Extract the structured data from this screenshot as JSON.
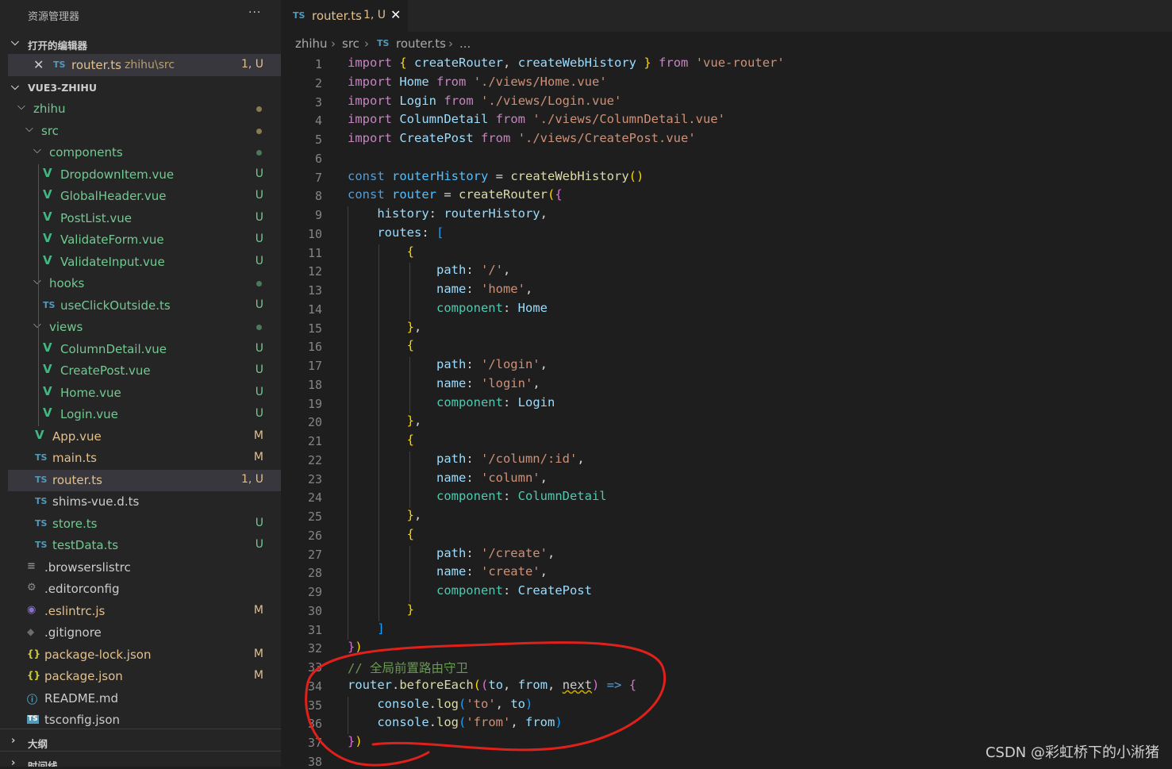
{
  "sidebar": {
    "title": "资源管理器",
    "more": "···",
    "open_editors_header": "打开的编辑器",
    "open_editor": {
      "close": "✕",
      "icon": "TS",
      "name": "router.ts",
      "path": "zhihu\\src",
      "status": "1, U"
    },
    "project_header": "VUE3-ZHIHU",
    "outline_header": "大纲",
    "timeline_header": "时间线",
    "tree": [
      {
        "label": "zhihu",
        "type": "folder",
        "depth": 1,
        "badge_dot": "#8a7a4f"
      },
      {
        "label": "src",
        "type": "folder",
        "depth": 2,
        "badge_dot": "#8a7a4f"
      },
      {
        "label": "components",
        "type": "folder",
        "depth": 3,
        "badge_dot": "#4b7a5a"
      },
      {
        "label": "DropdownItem.vue",
        "type": "vue",
        "depth": 4,
        "badge": "U"
      },
      {
        "label": "GlobalHeader.vue",
        "type": "vue",
        "depth": 4,
        "badge": "U"
      },
      {
        "label": "PostList.vue",
        "type": "vue",
        "depth": 4,
        "badge": "U"
      },
      {
        "label": "ValidateForm.vue",
        "type": "vue",
        "depth": 4,
        "badge": "U"
      },
      {
        "label": "ValidateInput.vue",
        "type": "vue",
        "depth": 4,
        "badge": "U"
      },
      {
        "label": "hooks",
        "type": "folder",
        "depth": 3,
        "badge_dot": "#4b7a5a"
      },
      {
        "label": "useClickOutside.ts",
        "type": "ts",
        "depth": 4,
        "badge": "U"
      },
      {
        "label": "views",
        "type": "folder",
        "depth": 3,
        "badge_dot": "#4b7a5a"
      },
      {
        "label": "ColumnDetail.vue",
        "type": "vue",
        "depth": 4,
        "badge": "U"
      },
      {
        "label": "CreatePost.vue",
        "type": "vue",
        "depth": 4,
        "badge": "U"
      },
      {
        "label": "Home.vue",
        "type": "vue",
        "depth": 4,
        "badge": "U"
      },
      {
        "label": "Login.vue",
        "type": "vue",
        "depth": 4,
        "badge": "U"
      },
      {
        "label": "App.vue",
        "type": "vue",
        "depth": 3,
        "badge": "M"
      },
      {
        "label": "main.ts",
        "type": "ts",
        "depth": 3,
        "badge": "M"
      },
      {
        "label": "router.ts",
        "type": "ts",
        "depth": 3,
        "badge": "1, U",
        "selected": true
      },
      {
        "label": "shims-vue.d.ts",
        "type": "ts",
        "depth": 3,
        "badge": ""
      },
      {
        "label": "store.ts",
        "type": "ts",
        "depth": 3,
        "badge": "U"
      },
      {
        "label": "testData.ts",
        "type": "ts",
        "depth": 3,
        "badge": "U"
      },
      {
        "label": ".browserslistrc",
        "type": "lines",
        "depth": 2,
        "badge": ""
      },
      {
        "label": ".editorconfig",
        "type": "cfg",
        "depth": 2,
        "badge": ""
      },
      {
        "label": ".eslintrc.js",
        "type": "eslint",
        "depth": 2,
        "badge": "M"
      },
      {
        "label": ".gitignore",
        "type": "git",
        "depth": 2,
        "badge": ""
      },
      {
        "label": "package-lock.json",
        "type": "json",
        "depth": 2,
        "badge": "M"
      },
      {
        "label": "package.json",
        "type": "json",
        "depth": 2,
        "badge": "M"
      },
      {
        "label": "README.md",
        "type": "info",
        "depth": 2,
        "badge": ""
      },
      {
        "label": "tsconfig.json",
        "type": "tsconf",
        "depth": 2,
        "badge": ""
      }
    ]
  },
  "tab": {
    "icon": "TS",
    "name": "router.ts",
    "status": "1, U",
    "close": "✕"
  },
  "breadcrumb": {
    "p1": "zhihu",
    "p2": "src",
    "icon": "TS",
    "p3": "router.ts",
    "p4": "..."
  },
  "watermark": "CSDN @彩虹桥下的小淅猪",
  "code_lines": [
    [
      [
        "kwc",
        "import"
      ],
      [
        "txt",
        " "
      ],
      [
        "b1",
        "{"
      ],
      [
        "txt",
        " "
      ],
      [
        "var",
        "createRouter"
      ],
      [
        "txt",
        ", "
      ],
      [
        "var",
        "createWebHistory"
      ],
      [
        "txt",
        " "
      ],
      [
        "b1",
        "}"
      ],
      [
        "txt",
        " "
      ],
      [
        "kwc",
        "from"
      ],
      [
        "txt",
        " "
      ],
      [
        "str",
        "'vue-router'"
      ]
    ],
    [
      [
        "kwc",
        "import"
      ],
      [
        "txt",
        " "
      ],
      [
        "var",
        "Home"
      ],
      [
        "txt",
        " "
      ],
      [
        "kwc",
        "from"
      ],
      [
        "txt",
        " "
      ],
      [
        "str",
        "'./views/Home.vue'"
      ]
    ],
    [
      [
        "kwc",
        "import"
      ],
      [
        "txt",
        " "
      ],
      [
        "var",
        "Login"
      ],
      [
        "txt",
        " "
      ],
      [
        "kwc",
        "from"
      ],
      [
        "txt",
        " "
      ],
      [
        "str",
        "'./views/Login.vue'"
      ]
    ],
    [
      [
        "kwc",
        "import"
      ],
      [
        "txt",
        " "
      ],
      [
        "var",
        "ColumnDetail"
      ],
      [
        "txt",
        " "
      ],
      [
        "kwc",
        "from"
      ],
      [
        "txt",
        " "
      ],
      [
        "str",
        "'./views/ColumnDetail.vue'"
      ]
    ],
    [
      [
        "kwc",
        "import"
      ],
      [
        "txt",
        " "
      ],
      [
        "var",
        "CreatePost"
      ],
      [
        "txt",
        " "
      ],
      [
        "kwc",
        "from"
      ],
      [
        "txt",
        " "
      ],
      [
        "str",
        "'./views/CreatePost.vue'"
      ]
    ],
    [],
    [
      [
        "kw",
        "const"
      ],
      [
        "txt",
        " "
      ],
      [
        "cst",
        "routerHistory"
      ],
      [
        "txt",
        " = "
      ],
      [
        "fn",
        "createWebHistory"
      ],
      [
        "b1",
        "()"
      ]
    ],
    [
      [
        "kw",
        "const"
      ],
      [
        "txt",
        " "
      ],
      [
        "cst",
        "router"
      ],
      [
        "txt",
        " = "
      ],
      [
        "fn",
        "createRouter"
      ],
      [
        "b1",
        "("
      ],
      [
        "b2",
        "{"
      ]
    ],
    [
      [
        "txt",
        "    "
      ],
      [
        "prop",
        "history"
      ],
      [
        "txt",
        ": "
      ],
      [
        "var",
        "routerHistory"
      ],
      [
        "txt",
        ","
      ]
    ],
    [
      [
        "txt",
        "    "
      ],
      [
        "prop",
        "routes"
      ],
      [
        "txt",
        ": "
      ],
      [
        "b3",
        "["
      ]
    ],
    [
      [
        "txt",
        "        "
      ],
      [
        "b1",
        "{"
      ]
    ],
    [
      [
        "txt",
        "            "
      ],
      [
        "prop",
        "path"
      ],
      [
        "txt",
        ": "
      ],
      [
        "str",
        "'/'"
      ],
      [
        "txt",
        ","
      ]
    ],
    [
      [
        "txt",
        "            "
      ],
      [
        "prop",
        "name"
      ],
      [
        "txt",
        ": "
      ],
      [
        "str",
        "'home'"
      ],
      [
        "txt",
        ","
      ]
    ],
    [
      [
        "txt",
        "            "
      ],
      [
        "cls",
        "component"
      ],
      [
        "txt",
        ": "
      ],
      [
        "var",
        "Home"
      ]
    ],
    [
      [
        "txt",
        "        "
      ],
      [
        "b1",
        "}"
      ],
      [
        "txt",
        ","
      ]
    ],
    [
      [
        "txt",
        "        "
      ],
      [
        "b1",
        "{"
      ]
    ],
    [
      [
        "txt",
        "            "
      ],
      [
        "prop",
        "path"
      ],
      [
        "txt",
        ": "
      ],
      [
        "str",
        "'/login'"
      ],
      [
        "txt",
        ","
      ]
    ],
    [
      [
        "txt",
        "            "
      ],
      [
        "prop",
        "name"
      ],
      [
        "txt",
        ": "
      ],
      [
        "str",
        "'login'"
      ],
      [
        "txt",
        ","
      ]
    ],
    [
      [
        "txt",
        "            "
      ],
      [
        "cls",
        "component"
      ],
      [
        "txt",
        ": "
      ],
      [
        "var",
        "Login"
      ]
    ],
    [
      [
        "txt",
        "        "
      ],
      [
        "b1",
        "}"
      ],
      [
        "txt",
        ","
      ]
    ],
    [
      [
        "txt",
        "        "
      ],
      [
        "b1",
        "{"
      ]
    ],
    [
      [
        "txt",
        "            "
      ],
      [
        "prop",
        "path"
      ],
      [
        "txt",
        ": "
      ],
      [
        "str",
        "'/column/:id'"
      ],
      [
        "txt",
        ","
      ]
    ],
    [
      [
        "txt",
        "            "
      ],
      [
        "prop",
        "name"
      ],
      [
        "txt",
        ": "
      ],
      [
        "str",
        "'column'"
      ],
      [
        "txt",
        ","
      ]
    ],
    [
      [
        "txt",
        "            "
      ],
      [
        "cls",
        "component"
      ],
      [
        "txt",
        ": "
      ],
      [
        "cls",
        "ColumnDetail"
      ]
    ],
    [
      [
        "txt",
        "        "
      ],
      [
        "b1",
        "}"
      ],
      [
        "txt",
        ","
      ]
    ],
    [
      [
        "txt",
        "        "
      ],
      [
        "b1",
        "{"
      ]
    ],
    [
      [
        "txt",
        "            "
      ],
      [
        "prop",
        "path"
      ],
      [
        "txt",
        ": "
      ],
      [
        "str",
        "'/create'"
      ],
      [
        "txt",
        ","
      ]
    ],
    [
      [
        "txt",
        "            "
      ],
      [
        "prop",
        "name"
      ],
      [
        "txt",
        ": "
      ],
      [
        "str",
        "'create'"
      ],
      [
        "txt",
        ","
      ]
    ],
    [
      [
        "txt",
        "            "
      ],
      [
        "cls",
        "component"
      ],
      [
        "txt",
        ": "
      ],
      [
        "var",
        "CreatePost"
      ]
    ],
    [
      [
        "txt",
        "        "
      ],
      [
        "b1",
        "}"
      ]
    ],
    [
      [
        "txt",
        "    "
      ],
      [
        "b3",
        "]"
      ]
    ],
    [
      [
        "b2",
        "}"
      ],
      [
        "b1",
        ")"
      ]
    ],
    [
      [
        "cmt",
        "// 全局前置路由守卫"
      ]
    ],
    [
      [
        "var",
        "router"
      ],
      [
        "txt",
        "."
      ],
      [
        "fn",
        "beforeEach"
      ],
      [
        "b1",
        "("
      ],
      [
        "b2",
        "("
      ],
      [
        "var",
        "to"
      ],
      [
        "txt",
        ", "
      ],
      [
        "var",
        "from"
      ],
      [
        "txt",
        ", "
      ],
      [
        "warn",
        "next"
      ],
      [
        "b2",
        ")"
      ],
      [
        "txt",
        " "
      ],
      [
        "kw",
        "=>"
      ],
      [
        "txt",
        " "
      ],
      [
        "b2",
        "{"
      ]
    ],
    [
      [
        "txt",
        "    "
      ],
      [
        "var",
        "console"
      ],
      [
        "txt",
        "."
      ],
      [
        "fn",
        "log"
      ],
      [
        "b3",
        "("
      ],
      [
        "str",
        "'to'"
      ],
      [
        "txt",
        ", "
      ],
      [
        "var",
        "to"
      ],
      [
        "b3",
        ")"
      ]
    ],
    [
      [
        "txt",
        "    "
      ],
      [
        "var",
        "console"
      ],
      [
        "txt",
        "."
      ],
      [
        "fn",
        "log"
      ],
      [
        "b3",
        "("
      ],
      [
        "str",
        "'from'"
      ],
      [
        "txt",
        ", "
      ],
      [
        "var",
        "from"
      ],
      [
        "b3",
        ")"
      ]
    ],
    [
      [
        "b2",
        "}"
      ],
      [
        "b1",
        ")"
      ]
    ],
    []
  ]
}
